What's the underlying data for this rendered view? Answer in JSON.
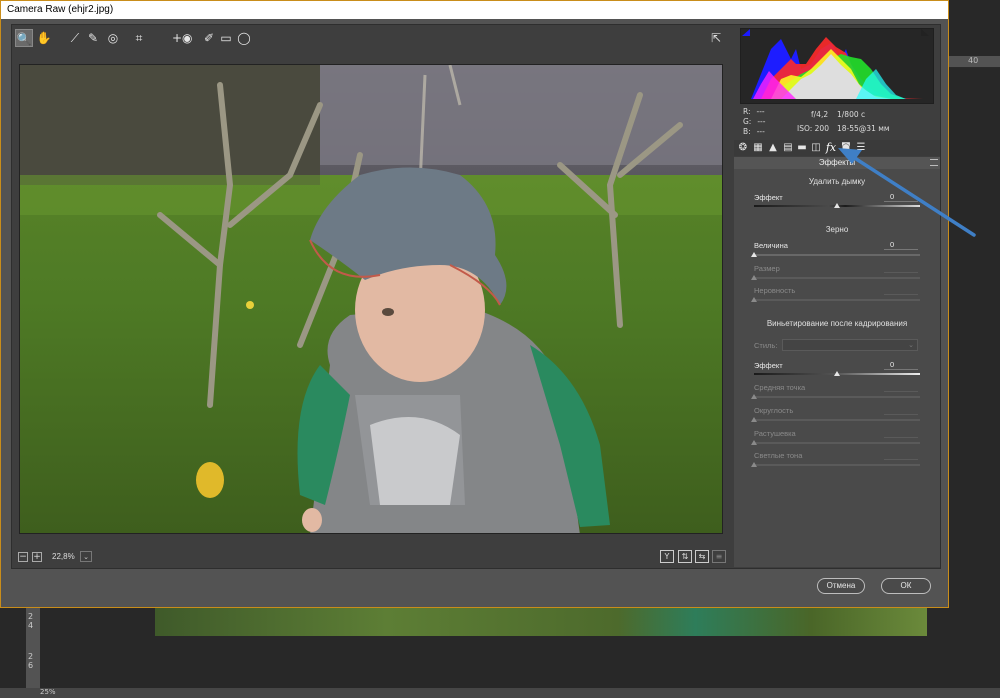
{
  "window": {
    "title": "Camera Raw (ehjr2.jpg)"
  },
  "toolbar": {
    "tools": [
      {
        "name": "zoom-tool",
        "glyph": "🔍"
      },
      {
        "name": "hand-tool",
        "glyph": "✋"
      },
      {
        "name": "white-balance-tool",
        "glyph": "⟋"
      },
      {
        "name": "color-sampler-tool",
        "glyph": "✎"
      },
      {
        "name": "targeted-adjustment-tool",
        "glyph": "◎"
      },
      {
        "name": "crop-tool",
        "glyph": "⌗"
      },
      {
        "name": "red-eye-tool",
        "glyph": "+◉"
      },
      {
        "name": "spot-removal-tool",
        "glyph": "✐"
      },
      {
        "name": "adjustment-brush-tool",
        "glyph": "▭"
      },
      {
        "name": "graduated-filter-tool",
        "glyph": "◯"
      }
    ]
  },
  "zoom": {
    "level": "22,8%",
    "minus": "−",
    "plus": "+",
    "arrow": "⌄"
  },
  "view_buttons": {
    "y": "Y",
    "swap": "⇅",
    "copy": "⇆",
    "menu": "≡"
  },
  "readout": {
    "r_label": "R:",
    "r_value": "---",
    "g_label": "G:",
    "g_value": "---",
    "b_label": "B:",
    "b_value": "---",
    "aperture": "f/4,2",
    "shutter": "1/800 с",
    "iso": "ISO: 200",
    "lens": "18-55@31 мм"
  },
  "panel": {
    "title": "Эффекты",
    "dehaze": {
      "heading": "Удалить дымку",
      "label": "Эффект",
      "value": "0"
    },
    "grain": {
      "heading": "Зерно",
      "amount_label": "Величина",
      "amount_value": "0",
      "size_label": "Размер",
      "roughness_label": "Неровность"
    },
    "vignette": {
      "heading": "Виньетирование после кадрирования",
      "style_label": "Стиль:",
      "amount_label": "Эффект",
      "amount_value": "0",
      "midpoint_label": "Средняя точка",
      "roundness_label": "Округлость",
      "feather_label": "Растушевка",
      "highlights_label": "Светлые тона"
    }
  },
  "buttons": {
    "cancel": "Отмена",
    "ok": "ОК"
  },
  "ps_background": {
    "ruler_top": "40",
    "ruler_left_a": "2\n4",
    "ruler_left_b": "2\n6",
    "status": "25%"
  },
  "colors": {
    "accent_border": "#c98d1a",
    "arrow": "#3f7fc6",
    "dialog_bg": "#535353"
  }
}
